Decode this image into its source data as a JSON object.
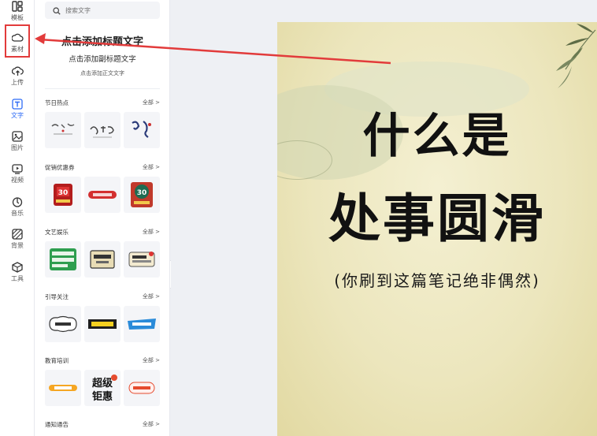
{
  "rail": {
    "items": [
      {
        "label": "模板",
        "icon": "template-icon"
      },
      {
        "label": "素材",
        "icon": "cloud-icon"
      },
      {
        "label": "上传",
        "icon": "upload-cloud-icon"
      },
      {
        "label": "文字",
        "icon": "text-t-icon"
      },
      {
        "label": "图片",
        "icon": "image-icon"
      },
      {
        "label": "视频",
        "icon": "video-icon"
      },
      {
        "label": "音乐",
        "icon": "music-icon"
      },
      {
        "label": "背景",
        "icon": "background-grid-icon"
      },
      {
        "label": "工具",
        "icon": "toolbox-icon"
      }
    ],
    "active_color": "#2f6cf6",
    "highlight_color": "#e23b3b"
  },
  "panel": {
    "search_placeholder": "搜索文字",
    "preset_title": "点击添加标题文字",
    "preset_subtitle": "点击添加副标题文字",
    "preset_body": "点击添加正文文字",
    "categories": [
      {
        "name": "节日热点",
        "all": "全部 >"
      },
      {
        "name": "促销优惠券",
        "all": "全部 >"
      },
      {
        "name": "文艺娱乐",
        "all": "全部 >"
      },
      {
        "name": "引导关注",
        "all": "全部 >"
      },
      {
        "name": "教育培训",
        "all": "全部 >"
      },
      {
        "name": "通知通告",
        "all": "全部 >"
      }
    ],
    "collapse_icon": "chevron-left-icon"
  },
  "thumb_text": {
    "badge_30": "30",
    "super": "超级",
    "deal": "钜惠"
  },
  "poster": {
    "line1": "什么是",
    "line2": "处事圆滑",
    "subtitle": "(你刷到这篇笔记绝非偶然)"
  },
  "annotation": {
    "arrow_color": "#e23b3b"
  }
}
